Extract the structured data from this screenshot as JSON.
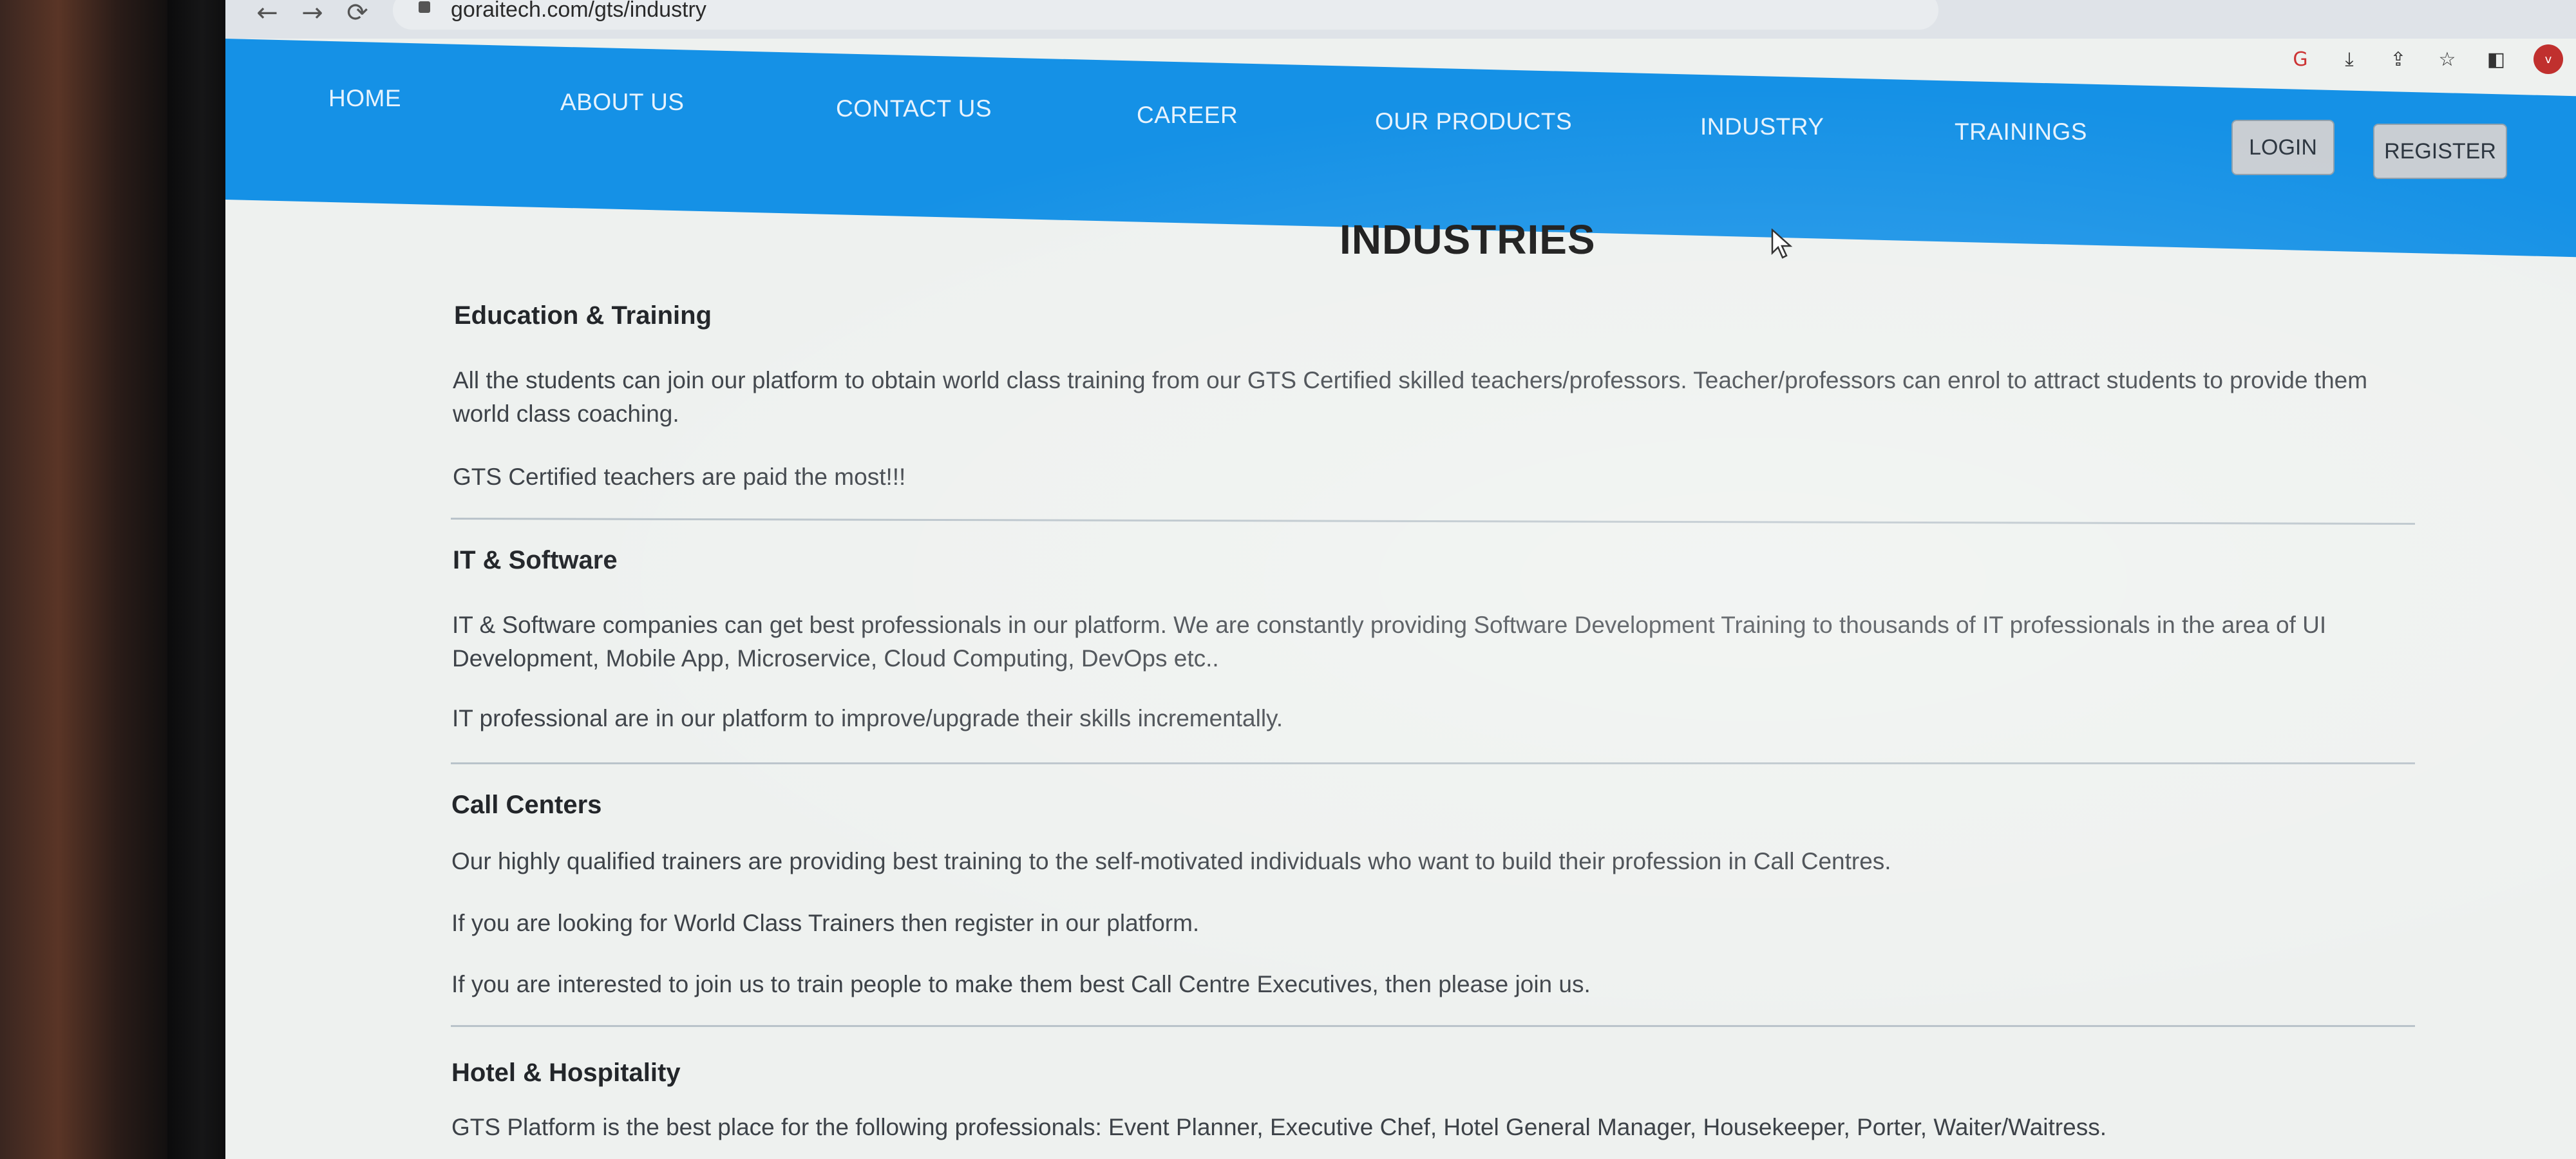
{
  "browser": {
    "url": "goraitech.com/gts/industry",
    "back_glyph": "←",
    "forward_glyph": "→",
    "reload_glyph": "⟳",
    "toolbar_icons": [
      "google-icon",
      "save-icon",
      "share-icon",
      "star-icon",
      "sidebar-icon"
    ],
    "google_glyph": "G",
    "save_glyph": "⤓",
    "share_glyph": "⇪",
    "star_glyph": "☆",
    "sidebar_glyph": "◧",
    "avatar_letter": "v"
  },
  "navbar": {
    "color": "#1591e6",
    "items": [
      "HOME",
      "ABOUT US",
      "CONTACT US",
      "CAREER",
      "OUR PRODUCTS",
      "INDUSTRY",
      "TRAININGS"
    ],
    "login": "LOGIN",
    "register": "REGISTER"
  },
  "page": {
    "title": "INDUSTRIES",
    "sections": [
      {
        "heading": "Education & Training",
        "paragraphs": [
          "All the students can join our platform to obtain world class training from our GTS Certified skilled teachers/professors. Teacher/professors can enrol to attract students to provide them world class coaching.",
          "GTS Certified teachers are paid the most!!!"
        ]
      },
      {
        "heading": "IT & Software",
        "paragraphs": [
          "IT & Software companies can get best professionals in our platform. We are constantly providing Software Development Training to thousands of IT professionals in the area of UI Development, Mobile App, Microservice, Cloud Computing, DevOps etc..",
          "IT professional are in our platform to improve/upgrade their skills incrementally."
        ]
      },
      {
        "heading": "Call Centers",
        "paragraphs": [
          "Our highly qualified trainers are providing best training to the self-motivated individuals who want to build their profession in Call Centres.",
          "If you are looking for World Class Trainers then register in our platform.",
          "If you are interested to join us to train people to make them best Call Centre Executives, then please join us."
        ]
      },
      {
        "heading": "Hotel & Hospitality",
        "paragraphs": [
          "GTS Platform is the best place for the following professionals: Event Planner, Executive Chef, Hotel General Manager, Housekeeper, Porter, Waiter/Waitress."
        ]
      }
    ]
  }
}
